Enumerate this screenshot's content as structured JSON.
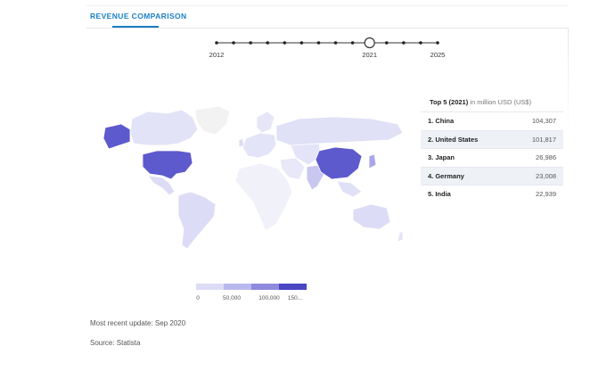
{
  "tab": {
    "label": "REVENUE COMPARISON"
  },
  "timeline": {
    "labels": [
      {
        "year": "2012",
        "index": 0
      },
      {
        "year": "2021",
        "index": 9
      },
      {
        "year": "2025",
        "index": 13
      }
    ],
    "years": 14,
    "selected_index": 9
  },
  "top5": {
    "title_bold": "Top 5 (2021)",
    "title_rest": " in million USD (US$)",
    "rows": [
      {
        "rank_name": "1. China",
        "value": "104,307"
      },
      {
        "rank_name": "2. United States",
        "value": "101,817"
      },
      {
        "rank_name": "3. Japan",
        "value": "26,986"
      },
      {
        "rank_name": "4. Germany",
        "value": "23,008"
      },
      {
        "rank_name": "5. India",
        "value": "22,939"
      }
    ]
  },
  "legend": {
    "ticks": [
      "0",
      "50,000",
      "100,000",
      "150..."
    ],
    "colors": [
      "#dcdcf6",
      "#b9b8ee",
      "#8e8bde",
      "#4a46c4"
    ]
  },
  "colors": {
    "accent": "#1b7fc4",
    "map_high": "#5d5acd",
    "map_low": "#e2e2f6",
    "map_nodata": "#f2f2f2"
  },
  "footer": {
    "update": "Most recent update: Sep 2020",
    "source": "Source: Statista"
  }
}
